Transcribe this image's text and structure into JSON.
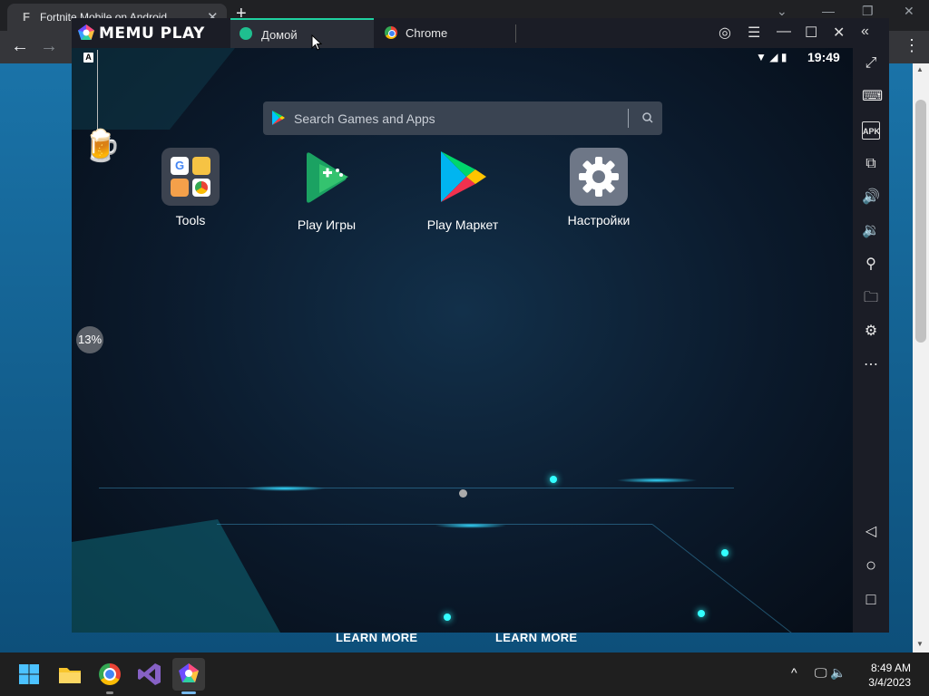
{
  "browser": {
    "tab_title": "Fortnite Mobile on Android",
    "tab_favicon_glyph": "F",
    "new_tab_glyph": "+",
    "close_glyph": "✕",
    "back_glyph": "←",
    "forward_glyph": "→",
    "menu_glyph": "⋮",
    "win_minimize_glyph": "—",
    "win_maximize_glyph": "❐",
    "win_close_glyph": "✕",
    "win_collapse_glyph": "⌄",
    "learn_more_1": "LEARN MORE",
    "learn_more_2": "LEARN MORE"
  },
  "memu": {
    "logo_text": "MEMU PLAY",
    "tabs": [
      {
        "label": "Домой",
        "icon": "memu-home-icon",
        "active": true
      },
      {
        "label": "Chrome",
        "icon": "chrome-icon",
        "active": false
      }
    ],
    "title_controls": {
      "account": "◎",
      "menu": "☰",
      "minimize": "—",
      "maximize": "☐",
      "close": "✕",
      "collapse": "«"
    },
    "status_bar": {
      "keyboard_badge": "A",
      "time": "19:49"
    },
    "search": {
      "placeholder": "Search Games and Apps"
    },
    "apps": [
      {
        "label": "Tools",
        "icon": "tools-folder-icon"
      },
      {
        "label": "Play Игры",
        "icon": "play-games-icon"
      },
      {
        "label": "Play Маркет",
        "icon": "play-store-icon"
      },
      {
        "label": "Настройки",
        "icon": "settings-gear-icon"
      }
    ],
    "boost_percent": "13%",
    "sidebar": [
      {
        "name": "fullscreen-icon",
        "glyph": "⤢"
      },
      {
        "name": "keyboard-icon",
        "glyph": "⌨"
      },
      {
        "name": "apk-icon",
        "glyph": "APK"
      },
      {
        "name": "multi-instance-icon",
        "glyph": "⧉"
      },
      {
        "name": "volume-up-icon",
        "glyph": "🔊"
      },
      {
        "name": "volume-down-icon",
        "glyph": "🔉"
      },
      {
        "name": "location-icon",
        "glyph": "⚲"
      },
      {
        "name": "folder-icon",
        "glyph": "🗀"
      },
      {
        "name": "settings-icon",
        "glyph": "⚙"
      },
      {
        "name": "more-icon",
        "glyph": "⋯"
      },
      {
        "name": "back-nav-icon",
        "glyph": "◁"
      },
      {
        "name": "home-nav-icon",
        "glyph": "○"
      },
      {
        "name": "recents-nav-icon",
        "glyph": "□"
      }
    ]
  },
  "taskbar": {
    "apps": [
      {
        "name": "start-button",
        "icon": "windows-icon"
      },
      {
        "name": "file-explorer",
        "icon": "folder-icon"
      },
      {
        "name": "chrome",
        "icon": "chrome-icon"
      },
      {
        "name": "visual-studio",
        "icon": "visual-studio-icon"
      },
      {
        "name": "memu",
        "icon": "memu-icon"
      }
    ],
    "tray_chevron": "^",
    "clock_time": "8:49 AM",
    "clock_date": "3/4/2023"
  },
  "colors": {
    "memu_accent": "#1fd1a0",
    "taskbar_active": "#76b9ed"
  }
}
